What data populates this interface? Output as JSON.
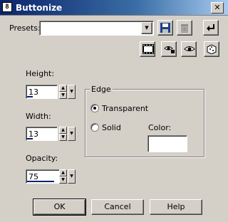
{
  "window": {
    "title": "Buttonize",
    "app_icon": "8"
  },
  "presets": {
    "label": "Presets:",
    "value": ""
  },
  "fields": {
    "height": {
      "label": "Height:",
      "value": "13",
      "level": 0.2
    },
    "width": {
      "label": "Width:",
      "value": "13",
      "level": 0.2
    },
    "opacity": {
      "label": "Opacity:",
      "value": "75",
      "level": 0.75
    }
  },
  "edge": {
    "label": "Edge",
    "options": [
      {
        "label": "Transparent",
        "selected": true
      },
      {
        "label": "Solid",
        "selected": false
      }
    ],
    "color_label": "Color:"
  },
  "buttons": {
    "ok": "OK",
    "cancel": "Cancel",
    "help": "Help"
  },
  "icons": {
    "save": "floppy-disk-icon",
    "delete": "trash-icon",
    "reset": "undo-arrow-icon",
    "film": "film-strip-icon",
    "eye_lock": "eye-lock-icon",
    "eye": "eye-icon",
    "dice": "randomize-dice-icon"
  },
  "colors": {
    "titlebar_start": "#0a246a",
    "titlebar_end": "#a6caf0",
    "face": "#d4d0c8",
    "level_bar": "#0a246a"
  }
}
